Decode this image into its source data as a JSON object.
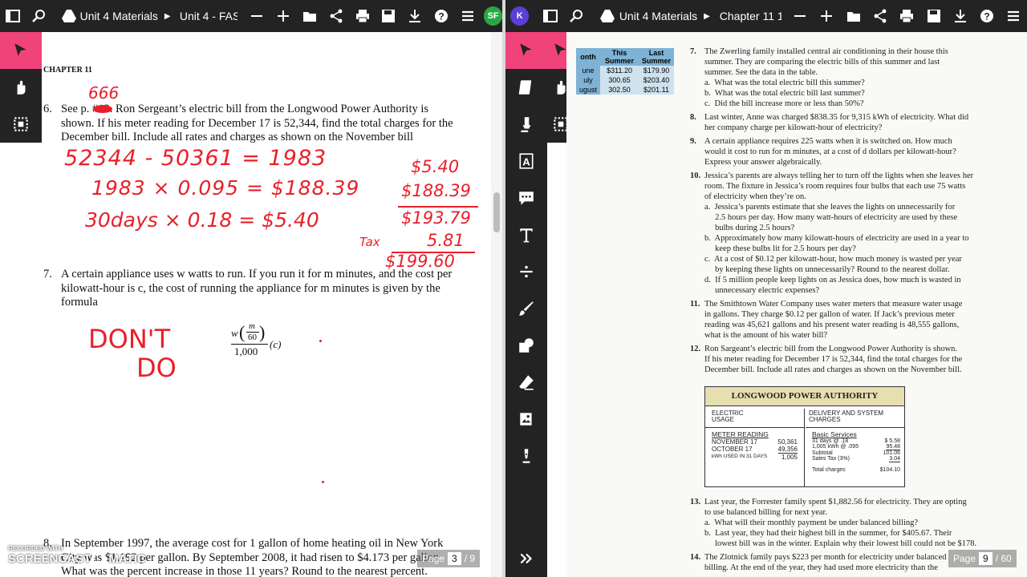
{
  "left": {
    "breadcrumb": [
      "Unit 4 Materials",
      "Unit 4 - FAS"
    ],
    "avatar": "SF",
    "chapter": "CHAPTER 11",
    "q6": {
      "num": "6.",
      "lines": [
        "See p.        #12.  Ron Sergeant’s electric bill from the Longwood Power Authority is",
        "shown.  If his meter reading for December 17 is 52,344, find the total charges for the",
        "December bill.  Include all rates and charges as shown on the November bill"
      ]
    },
    "q7": {
      "num": "7.",
      "lines": [
        "A certain appliance uses w watts to run.  If you run it for m minutes, and the cost per",
        "kilowatt-hour is c, the cost of running the appliance for m minutes is given by the",
        "formula"
      ],
      "formula_w": "w",
      "formula_m": "m",
      "formula_60": "60",
      "formula_den": "1,000",
      "formula_c": "(c)"
    },
    "q8": {
      "num": "8.",
      "lines": [
        "In September 1997, the average cost for 1 gallon of home heating oil in New York",
        "City was $1.192 per gallon.  By September 2008, it had risen to $4.173 per gallon.",
        "What was the percent increase in those 11 years?  Round to the nearest percent."
      ]
    },
    "handwriting": {
      "page_ref": "666",
      "line1": "52344 - 50361 = 1983",
      "line2": "1983 × 0.095 = $188.39",
      "line3": "30days × 0.18 = $5.40",
      "col1": "$5.40",
      "col2": "$188.39",
      "col3": "$193.79",
      "tax_label": "Tax",
      "col4": "5.81",
      "col5": "$199.60",
      "dont": "DON'T",
      "do": "DO"
    },
    "page": {
      "label": "Page",
      "current": "3",
      "total": "/ 9"
    },
    "watermark": {
      "line1": "RECORDED WITH",
      "line2": "SCREENCAST",
      "line3": "MATIC"
    }
  },
  "right": {
    "breadcrumb": [
      "Unit 4 Materials",
      "Chapter 11 1"
    ],
    "avatar": "K",
    "table": {
      "headers": [
        "onth",
        "This Summer",
        "Last Summer"
      ],
      "rows": [
        [
          "une",
          "$311.20",
          "$179.90"
        ],
        [
          "uly",
          "300.65",
          "$203.40"
        ],
        [
          "ugust",
          "302.50",
          "$201.11"
        ]
      ]
    },
    "questions": [
      {
        "num": "7.",
        "lines": [
          "The Zwerling family installed central air conditioning in their house this",
          "summer. They are comparing the electric bills of this summer and last",
          "summer. See the data in the table.",
          "a.  What was the total electric bill this summer?",
          "b.  What was the total electric bill last summer?",
          "c.  Did the bill increase more or less than 50%?"
        ]
      },
      {
        "num": "8.",
        "lines": [
          "Last winter, Anne was charged $838.35 for 9,315 kWh of electricity. What did",
          "her company charge per kilowatt-hour of electricity?"
        ]
      },
      {
        "num": "9.",
        "lines": [
          "A certain appliance requires 225 watts when it is switched on. How much",
          "would it cost to run for m minutes, at a cost of d dollars per kilowatt-hour?",
          "Express your answer algebraically."
        ]
      },
      {
        "num": "10.",
        "lines": [
          "Jessica’s parents are always telling her to turn off the lights when she leaves her",
          "room. The fixture in Jessica’s room requires four bulbs that each use 75 watts",
          "of electricity when they’re on.",
          "a.  Jessica’s parents estimate that she leaves the lights on unnecessarily for",
          "     2.5 hours per day. How many watt-hours of electricity are used by these",
          "     bulbs during 2.5 hours?",
          "b.  Approximately how many kilowatt-hours of electricity are used in a year to",
          "     keep these bulbs lit for 2.5 hours per day?",
          "c.  At a cost of $0.12 per kilowatt-hour, how much money is wasted per year",
          "     by keeping these lights on unnecessarily? Round to the nearest dollar.",
          "d.  If 5 million people keep lights on as Jessica does, how much is wasted in",
          "     unnecessary electric expenses?"
        ]
      },
      {
        "num": "11.",
        "lines": [
          "The Smithtown Water Company uses water meters that measure water usage",
          "in gallons. They charge $0.12 per gallon of water. If Jack’s previous meter",
          "reading was 45,621 gallons and his present water reading is 48,555 gallons,",
          "what is the amount of his water bill?"
        ]
      },
      {
        "num": "12.",
        "lines": [
          "Ron Sargeant’s electric bill from the Longwood Power Authority is shown.",
          "If his meter reading for December 17 is 52,344, find the total charges for the",
          "December bill. Include all rates and charges as shown on the November bill."
        ]
      }
    ],
    "bill": {
      "title": "LONGWOOD POWER AUTHORITY",
      "left_head": "ELECTRIC USAGE",
      "right_head": "DELIVERY AND SYSTEM CHARGES",
      "meter_title": "METER READING",
      "nov": "NOVEMBER 17",
      "nov_val": "50,361",
      "oct": "OCTOBER 17",
      "oct_val": "49,356",
      "kwh_label": "kWh USED IN 31 DAYS",
      "kwh_val": "1,005",
      "basic": "Basic Services",
      "days": "31 days @ .18",
      "days_val": "$  5.58",
      "kwh_rate": "1,005 kWh @ .095",
      "kwh_rate_val": "95.48",
      "subtotal": "Subtotal",
      "subtotal_val": "101.06",
      "tax": "Sales Tax (3%)",
      "tax_val": "3.04",
      "total": "Total charges",
      "total_val": "$104.10"
    },
    "q13": {
      "num": "13.",
      "lines": [
        "Last year, the Forrester family spent $1,882.56 for electricity. They are opting",
        "to use balanced billing for next year.",
        "a.  What will their monthly payment be under balanced billing?",
        "b.  Last year, they had their highest bill in the summer, for $405.67. Their",
        "     lowest bill was in the winter. Explain why their lowest bill could not be $178."
      ]
    },
    "q14": {
      "num": "14.",
      "lines": [
        "The Zlotnick family pays $223 per month for electricity under balanced",
        "billing. At the end of the year, they had used more electricity than the"
      ]
    },
    "page": {
      "label": "Page",
      "current": "9",
      "total": "/ 60"
    }
  },
  "colors": {
    "topbar": "#232323",
    "accent": "#f0437a",
    "ink": "#e8202a",
    "avatar_left": "#2aa745",
    "avatar_right": "#5b3fd6"
  }
}
